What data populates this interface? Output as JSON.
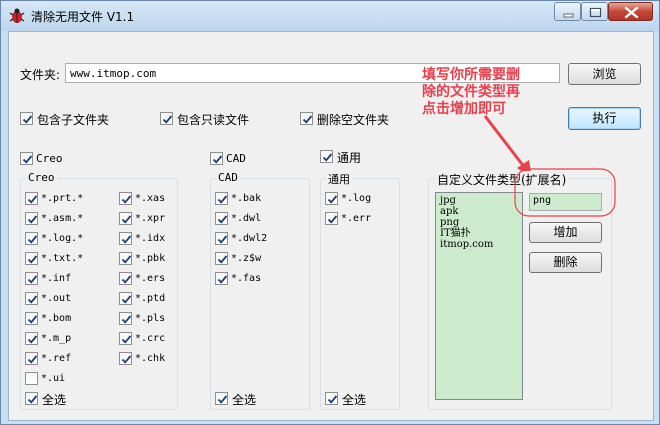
{
  "window": {
    "title": "清除无用文件 V1.1",
    "icon": "bug-icon",
    "accent": "#e8414d"
  },
  "folder": {
    "label": "文件夹:",
    "value": "www.itmop.com",
    "browse_label": "浏览"
  },
  "options": [
    {
      "label": "包含子文件夹",
      "checked": true
    },
    {
      "label": "包含只读文件",
      "checked": true
    },
    {
      "label": "删除空文件夹",
      "checked": true
    }
  ],
  "execute_label": "执行",
  "annotation": {
    "lines": [
      "填写你所需要删",
      "除的文件类型再",
      "点击增加即可"
    ],
    "color": "#e8414d"
  },
  "groups": {
    "creo": {
      "master_label": "Creo",
      "title": "Creo",
      "select_all": "全选",
      "col1": [
        {
          "label": "*.prt.*",
          "checked": true
        },
        {
          "label": "*.asm.*",
          "checked": true
        },
        {
          "label": "*.log.*",
          "checked": true
        },
        {
          "label": "*.txt.*",
          "checked": true
        },
        {
          "label": "*.inf",
          "checked": true
        },
        {
          "label": "*.out",
          "checked": true
        },
        {
          "label": "*.bom",
          "checked": true
        },
        {
          "label": "*.m_p",
          "checked": true
        },
        {
          "label": "*.ref",
          "checked": true
        },
        {
          "label": "*.ui",
          "checked": false
        }
      ],
      "col2": [
        {
          "label": "*.xas",
          "checked": true
        },
        {
          "label": "*.xpr",
          "checked": true
        },
        {
          "label": "*.idx",
          "checked": true
        },
        {
          "label": "*.pbk",
          "checked": true
        },
        {
          "label": "*.ers",
          "checked": true
        },
        {
          "label": "*.ptd",
          "checked": true
        },
        {
          "label": "*.pls",
          "checked": true
        },
        {
          "label": "*.crc",
          "checked": true
        },
        {
          "label": "*.chk",
          "checked": true
        }
      ]
    },
    "cad": {
      "master_label": "CAD",
      "title": "CAD",
      "select_all": "全选",
      "items": [
        {
          "label": "*.bak",
          "checked": true
        },
        {
          "label": "*.dwl",
          "checked": true
        },
        {
          "label": "*.dwl2",
          "checked": true
        },
        {
          "label": "*.z$w",
          "checked": true
        },
        {
          "label": "*.fas",
          "checked": true
        }
      ]
    },
    "general": {
      "master_label": "通用",
      "title": "通用",
      "select_all": "全选",
      "items": [
        {
          "label": "*.log",
          "checked": true
        },
        {
          "label": "*.err",
          "checked": true
        }
      ]
    }
  },
  "custom": {
    "title": "自定义文件类型(扩展名)",
    "list": [
      "jpg",
      "apk",
      "png",
      "IT猫扑",
      "itmop.com"
    ],
    "input_value": "png",
    "add_label": "增加",
    "delete_label": "删除"
  }
}
